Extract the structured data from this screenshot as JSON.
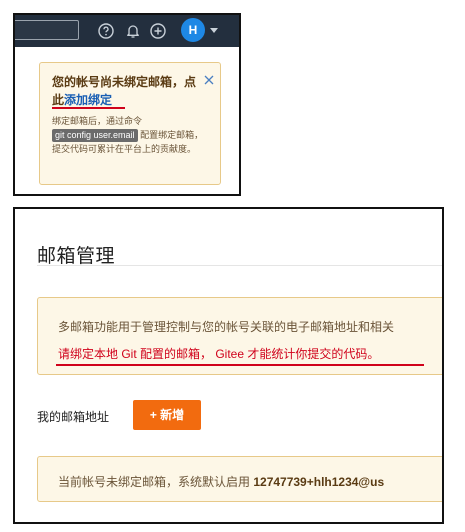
{
  "colors": {
    "navbar": "#232f3e",
    "accent_orange": "#f26b0f",
    "warning_bg": "#fdf7e7",
    "warning_border": "#e7c989",
    "link_blue": "#1a5fb4",
    "annotation_red": "#d0021b",
    "avatar_blue": "#1e88e5"
  },
  "navbar": {
    "icons": [
      "help-icon",
      "bell-icon",
      "plus-circle-icon"
    ],
    "avatar_initial": "H"
  },
  "popup": {
    "title_prefix": "您的帐号尚未绑定邮箱，点此",
    "title_link": "添加绑定",
    "body_before": "绑定邮箱后，通过命令",
    "code": "git config user.email",
    "body_after": "配置绑定邮箱，提交代码可累计在平台上的贡献度。"
  },
  "main": {
    "title": "邮箱管理",
    "info_line1": "多邮箱功能用于管理控制与您的帐号关联的电子邮箱地址和相关",
    "info_line2": "请绑定本地 Git 配置的邮箱， Gitee 才能统计你提交的代码。",
    "my_mail_label": "我的邮箱地址",
    "add_button": "+ 新增",
    "default_prefix": "当前帐号未绑定邮箱，系统默认启用 ",
    "default_email": "12747739+hlh1234@us"
  }
}
